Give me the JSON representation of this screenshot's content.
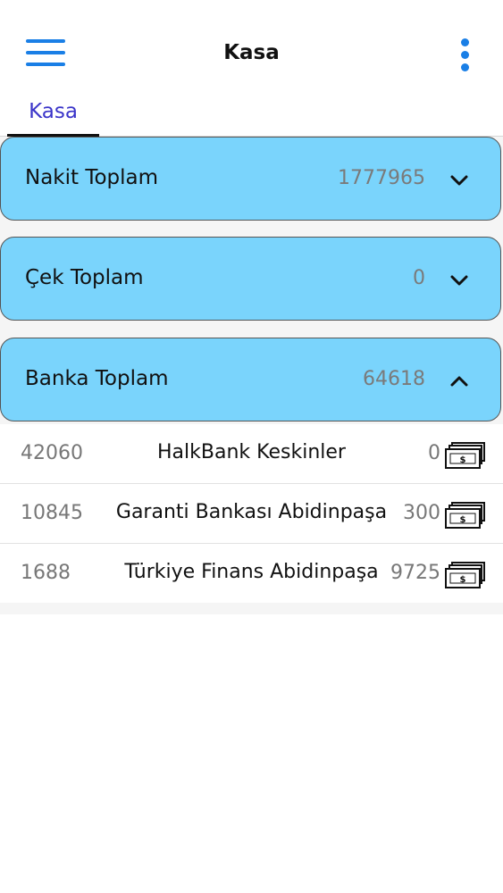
{
  "header": {
    "title": "Kasa"
  },
  "tabs": [
    {
      "label": "Kasa"
    }
  ],
  "cards": [
    {
      "label": "Nakit Toplam",
      "value": "1777965",
      "expanded": false
    },
    {
      "label": "Çek Toplam",
      "value": "0",
      "expanded": false
    },
    {
      "label": "Banka Toplam",
      "value": "64618",
      "expanded": true
    }
  ],
  "bank_rows": [
    {
      "code": "42060",
      "name": "HalkBank Keskinler",
      "amount": "0"
    },
    {
      "code": "10845",
      "name": "Garanti Bankası Abidinpaşa",
      "amount": "300"
    },
    {
      "code": "1688",
      "name": "Türkiye Finans  Abidinpaşa",
      "amount": "9725"
    }
  ],
  "icons": {
    "menu": "hamburger-menu-icon",
    "more": "more-vertical-icon",
    "collapsed": "chevron-down-icon",
    "expanded": "chevron-up-icon",
    "money": "money-stack-icon"
  },
  "colors": {
    "accent": "#1a7fe6",
    "tab_text": "#3b35c9",
    "card_bg": "#7ad4fc"
  }
}
